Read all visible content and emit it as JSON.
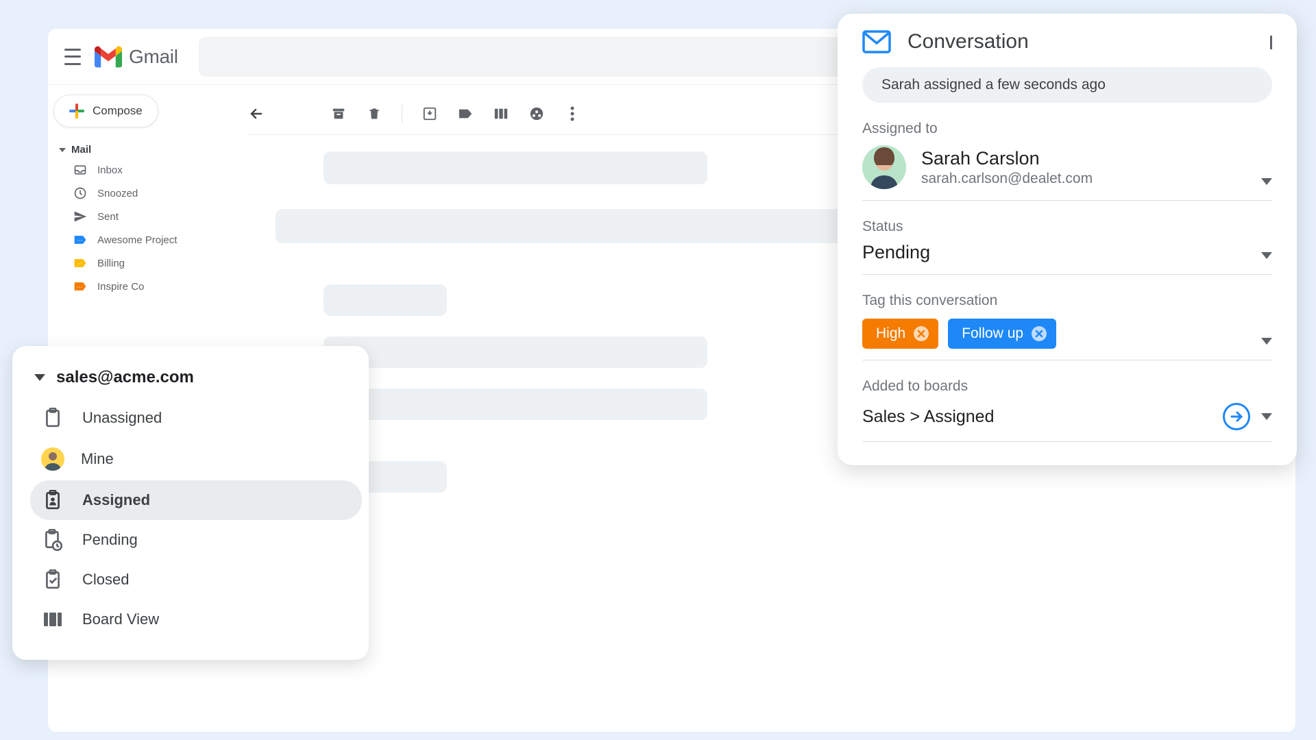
{
  "app": {
    "name": "Gmail",
    "compose": "Compose"
  },
  "mailTree": {
    "header": "Mail",
    "items": [
      {
        "label": "Inbox",
        "icon": "inbox"
      },
      {
        "label": "Snoozed",
        "icon": "clock"
      },
      {
        "label": "Sent",
        "icon": "send"
      },
      {
        "label": "Awesome Project",
        "icon": "tag-blue"
      },
      {
        "label": "Billing",
        "icon": "tag-yellow"
      },
      {
        "label": "Inspire Co",
        "icon": "tag-orange"
      }
    ]
  },
  "overlay": {
    "account": "sales@acme.com",
    "items": [
      {
        "label": "Unassigned",
        "icon": "clipboard"
      },
      {
        "label": "Mine",
        "icon": "avatar"
      },
      {
        "label": "Assigned",
        "icon": "clipboard-user",
        "active": true
      },
      {
        "label": "Pending",
        "icon": "clipboard-clock"
      },
      {
        "label": "Closed",
        "icon": "clipboard-check"
      },
      {
        "label": "Board View",
        "icon": "board"
      }
    ]
  },
  "panel": {
    "title": "Conversation",
    "status_line": "Sarah assigned a few seconds ago",
    "assigned_label": "Assigned to",
    "assignee": {
      "name": "Sarah Carslon",
      "email": "sarah.carlson@dealet.com"
    },
    "status_label": "Status",
    "status_value": "Pending",
    "tag_label": "Tag this conversation",
    "tags": [
      {
        "label": "High",
        "color": "orange"
      },
      {
        "label": "Follow up",
        "color": "blue"
      }
    ],
    "boards_label": "Added to boards",
    "boards_value": "Sales > Assigned"
  }
}
